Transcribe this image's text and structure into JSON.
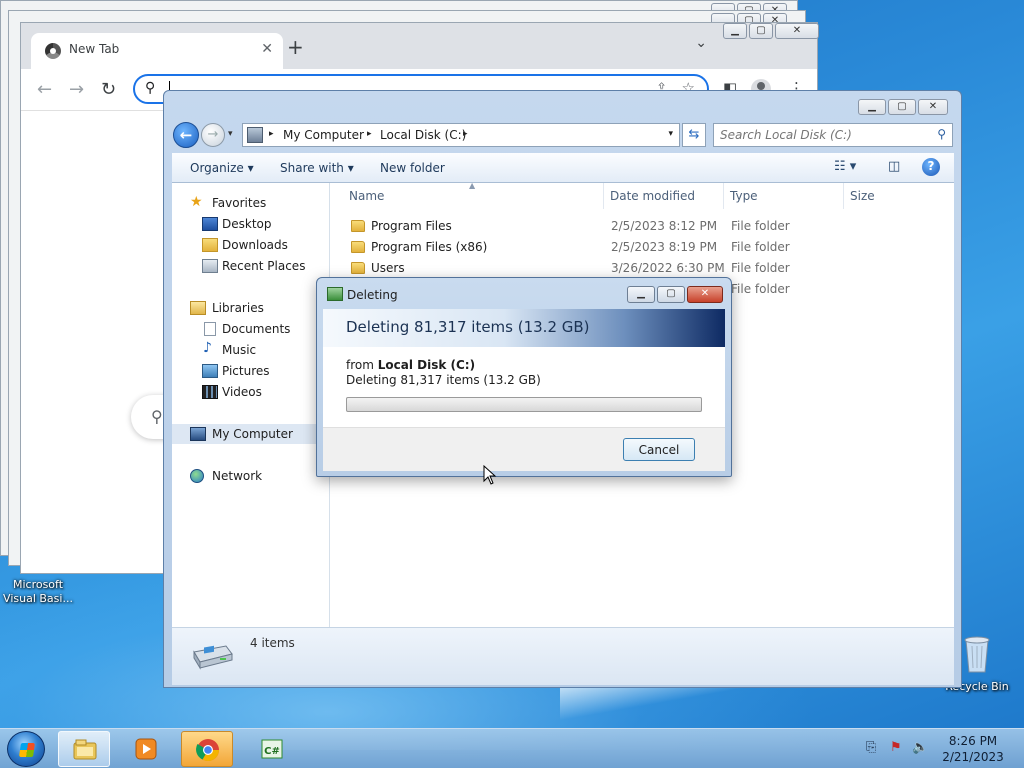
{
  "desktop": {
    "icons": [
      {
        "label_line1": "Microsoft",
        "label_line2": "Visual Basi..."
      },
      {
        "label_line1": "Recycle Bin",
        "label_line2": ""
      }
    ]
  },
  "chrome": {
    "tab_title": "New Tab",
    "tab_close": "✕",
    "new_tab": "+",
    "tab_menu": "⌄",
    "nav_back": "←",
    "nav_forward": "→",
    "nav_reload": "↻",
    "omnibox_value": "",
    "omnibox_search_glyph": "⚲",
    "share_glyph": "⇪",
    "star_glyph": "☆",
    "sidepanel_glyph": "◧",
    "menu_glyph": "⋮",
    "search_pill_glyph": "⚲",
    "win_min": "▁",
    "win_max": "▢",
    "win_close": "✕"
  },
  "explorer": {
    "win_min": "▁",
    "win_max": "▢",
    "win_close": "✕",
    "back_glyph": "←",
    "forward_glyph": "→",
    "nav_dropdown": "▾",
    "breadcrumb": [
      "My Computer",
      "Local Disk (C:)"
    ],
    "breadcrumb_sep": "▸",
    "address_dropdown": "▾",
    "refresh_glyph": "⇆",
    "search_placeholder": "Search Local Disk (C:)",
    "search_glyph": "⚲",
    "commands": {
      "organize": "Organize ▾",
      "share_with": "Share with ▾",
      "new_folder": "New folder"
    },
    "view_glyph": "☷ ▾",
    "preview_glyph": "◫",
    "help_glyph": "?",
    "nav_pane": {
      "favorites": "Favorites",
      "desktop": "Desktop",
      "downloads": "Downloads",
      "recent_places": "Recent Places",
      "libraries": "Libraries",
      "documents": "Documents",
      "music": "Music",
      "pictures": "Pictures",
      "videos": "Videos",
      "my_computer": "My Computer",
      "network": "Network"
    },
    "columns": {
      "name": "Name",
      "date_modified": "Date modified",
      "type": "Type",
      "size": "Size"
    },
    "sort_glyph": "▲",
    "files": [
      {
        "name": "Program Files",
        "date": "2/5/2023 8:12 PM",
        "type": "File folder"
      },
      {
        "name": "Program Files (x86)",
        "date": "2/5/2023 8:19 PM",
        "type": "File folder"
      },
      {
        "name": "Users",
        "date": "3/26/2022 6:30 PM",
        "type": "File folder"
      },
      {
        "name": "",
        "date": "",
        "type": "File folder"
      }
    ],
    "items_count": "4 items"
  },
  "dialog": {
    "title": "Deleting",
    "heading": "Deleting 81,317 items (13.2 GB)",
    "from_prefix": "from ",
    "from_location": "Local Disk (C:)",
    "status": "Deleting 81,317 items (13.2 GB)",
    "progress_fraction": 0.0,
    "cancel_label": "Cancel",
    "btn_min": "▁",
    "btn_max": "▢",
    "btn_close": "✕"
  },
  "taskbar": {
    "time": "8:26 PM",
    "date": "2/21/2023",
    "csharp_label": "C#",
    "tray_glyphs": {
      "network": "⎘",
      "flag": "⚑",
      "volume": "🔈"
    }
  },
  "colors": {
    "selection": "#dde7f3",
    "accent_blue": "#1a73e8",
    "dialog_banner_dark": "#0e2a63"
  }
}
